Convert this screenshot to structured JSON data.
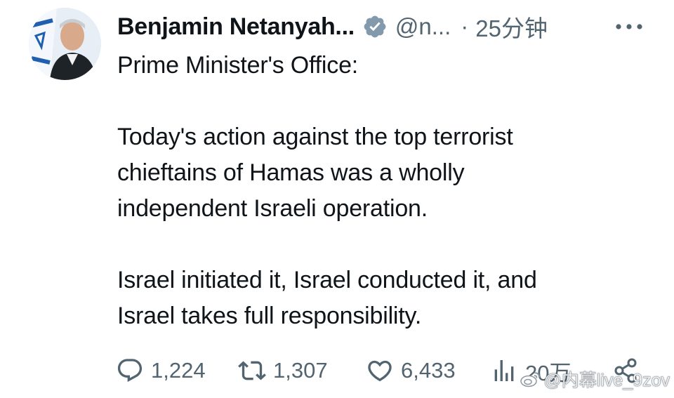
{
  "tweet": {
    "author_name": "Benjamin Netanyah...",
    "handle": "@n...",
    "separator": "·",
    "time": "25分钟",
    "lines": [
      "Prime Minister's Office:",
      "Today's action against the top terrorist",
      "chieftains of Hamas was a wholly",
      "independent Israeli operation.",
      "Israel initiated it, Israel conducted it, and",
      "Israel takes full responsibility."
    ]
  },
  "actions": {
    "reply_count": "1,224",
    "retweet_count": "1,307",
    "like_count": "6,433",
    "views_count": "20万"
  },
  "watermark": {
    "text": "@内幕live_9zov"
  },
  "icons": {
    "verified": "verified-badge-icon",
    "more": "more-options-icon",
    "reply": "reply-icon",
    "retweet": "retweet-icon",
    "like": "heart-icon",
    "views": "views-icon",
    "share": "share-icon",
    "watermark_logo": "weibo-logo-icon"
  },
  "colors": {
    "text": "#0f1419",
    "secondary": "#536471",
    "verified_badge": "#829aab",
    "background": "#ffffff"
  }
}
